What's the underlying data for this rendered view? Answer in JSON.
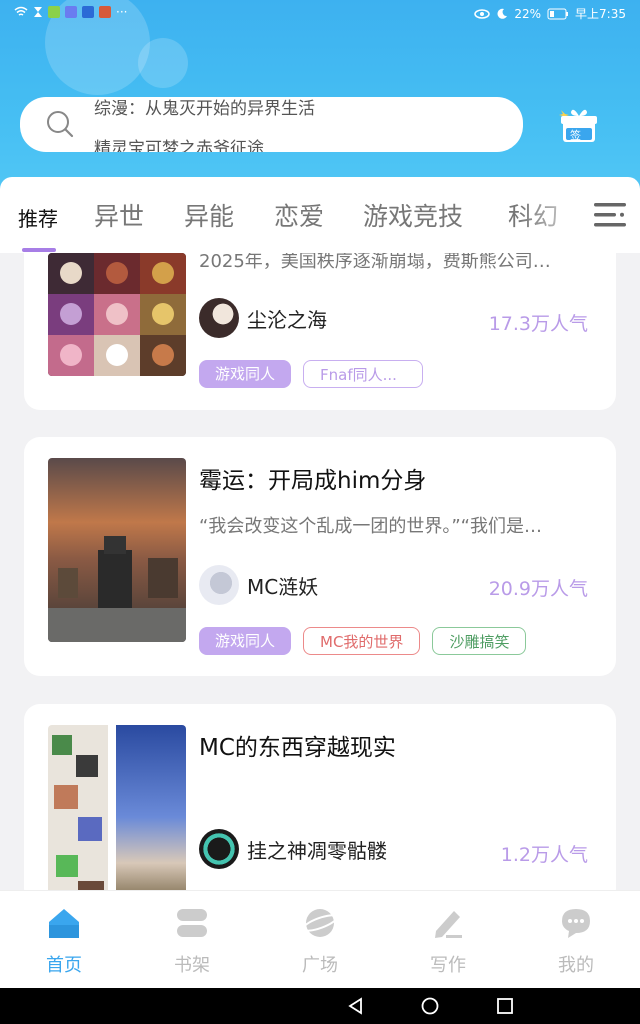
{
  "status": {
    "battery": "22%",
    "time": "早上7:35"
  },
  "search": {
    "lines": [
      "综漫：从鬼灭开始的异界生活",
      "精灵宝可梦之赤爷征途"
    ]
  },
  "checkin": {
    "label": "签"
  },
  "tabs": [
    "推荐",
    "异世",
    "异能",
    "恋爱",
    "游戏竞技",
    "科幻"
  ],
  "active_tab": "推荐",
  "cards": [
    {
      "desc": "2025年，美国秩序逐渐崩塌，费斯熊公司…",
      "author": "尘沦之海",
      "popularity": "17.3万人气",
      "tags": [
        "游戏同人",
        "Fnaf同人..."
      ]
    },
    {
      "title": "霉运：开局成him分身",
      "desc": "“我会改变这个乱成一团的世界。”“我们是…",
      "author": "MC涟妖",
      "popularity": "20.9万人气",
      "tags": [
        "游戏同人",
        "MC我的世界",
        "沙雕搞笑"
      ]
    },
    {
      "title": "MC的东西穿越现实",
      "author": "挂之神凋零骷髅",
      "popularity": "1.2万人气"
    }
  ],
  "nav": [
    {
      "label": "首页",
      "icon": "home-icon",
      "active": true
    },
    {
      "label": "书架",
      "icon": "bookshelf-icon"
    },
    {
      "label": "广场",
      "icon": "plaza-icon"
    },
    {
      "label": "写作",
      "icon": "write-icon"
    },
    {
      "label": "我的",
      "icon": "profile-icon"
    }
  ],
  "colors": {
    "header": "#46bff3",
    "accent": "#a77ee6",
    "nav_active": "#3aa6ee",
    "popularity": "#b99be8"
  }
}
